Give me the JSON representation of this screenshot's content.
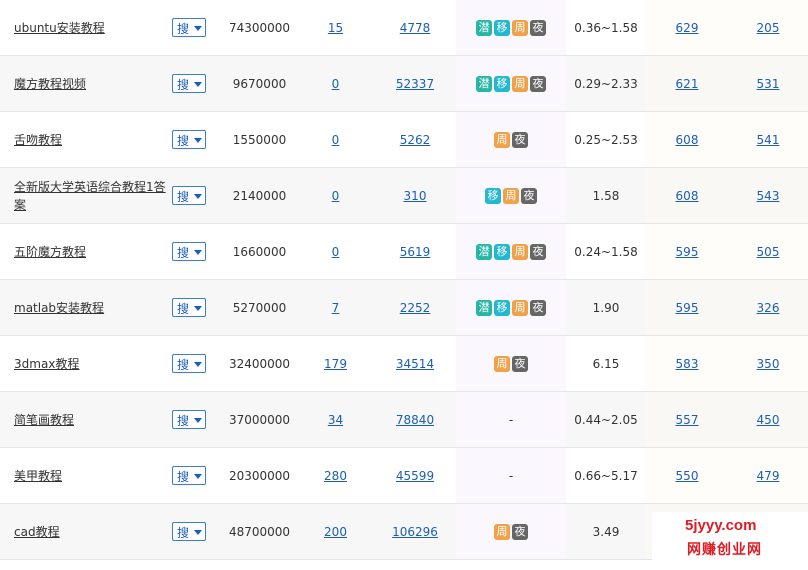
{
  "search_button_label": "搜",
  "rows": [
    {
      "keyword": "ubuntu安装教程",
      "index": "74300000",
      "link1": "15",
      "link2": "4778",
      "tags": [
        "潜",
        "移",
        "周",
        "夜"
      ],
      "range": "0.36~1.58",
      "r1": "629",
      "r2": "205"
    },
    {
      "keyword": "魔方教程视频",
      "index": "9670000",
      "link1": "0",
      "link2": "52337",
      "tags": [
        "潜",
        "移",
        "周",
        "夜"
      ],
      "range": "0.29~2.33",
      "r1": "621",
      "r2": "531"
    },
    {
      "keyword": "舌吻教程",
      "index": "1550000",
      "link1": "0",
      "link2": "5262",
      "tags": [
        "周",
        "夜"
      ],
      "range": "0.25~2.53",
      "r1": "608",
      "r2": "541"
    },
    {
      "keyword": "全新版大学英语综合教程1答案",
      "index": "2140000",
      "link1": "0",
      "link2": "310",
      "tags": [
        "移",
        "周",
        "夜"
      ],
      "range": "1.58",
      "r1": "608",
      "r2": "543"
    },
    {
      "keyword": "五阶魔方教程",
      "index": "1660000",
      "link1": "0",
      "link2": "5619",
      "tags": [
        "潜",
        "移",
        "周",
        "夜"
      ],
      "range": "0.24~1.58",
      "r1": "595",
      "r2": "505"
    },
    {
      "keyword": "matlab安装教程",
      "index": "5270000",
      "link1": "7",
      "link2": "2252",
      "tags": [
        "潜",
        "移",
        "周",
        "夜"
      ],
      "range": "1.90",
      "r1": "595",
      "r2": "326"
    },
    {
      "keyword": "3dmax教程",
      "index": "32400000",
      "link1": "179",
      "link2": "34514",
      "tags": [
        "周",
        "夜"
      ],
      "range": "6.15",
      "r1": "583",
      "r2": "350"
    },
    {
      "keyword": "简笔画教程",
      "index": "37000000",
      "link1": "34",
      "link2": "78840",
      "tags": [],
      "tags_empty": "-",
      "range": "0.44~2.05",
      "r1": "557",
      "r2": "450"
    },
    {
      "keyword": "美甲教程",
      "index": "20300000",
      "link1": "280",
      "link2": "45599",
      "tags": [],
      "tags_empty": "-",
      "range": "0.66~5.17",
      "r1": "550",
      "r2": "479"
    },
    {
      "keyword": "cad教程",
      "index": "48700000",
      "link1": "200",
      "link2": "106296",
      "tags": [
        "周",
        "夜"
      ],
      "range": "3.49",
      "r1": "",
      "r2": ""
    }
  ],
  "watermark": {
    "line1": "5jyyy.com",
    "line2": "网赚创业网"
  },
  "tag_colors": {
    "潜": "#29b6a5",
    "移": "#22b8cf",
    "周": "#f0a24a",
    "夜": "#666666"
  }
}
